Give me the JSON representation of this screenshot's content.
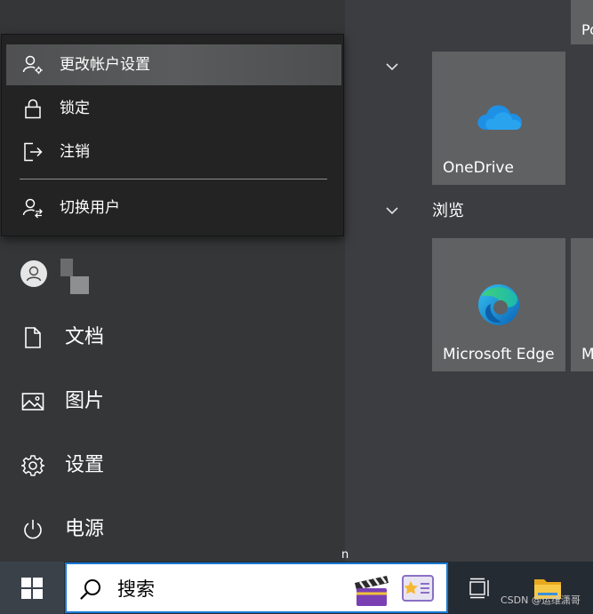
{
  "flyout": {
    "items": [
      {
        "label": "更改帐户设置",
        "icon": "account-settings-icon"
      },
      {
        "label": "锁定",
        "icon": "lock-icon"
      },
      {
        "label": "注销",
        "icon": "sign-out-icon"
      },
      {
        "label": "切换用户",
        "icon": "switch-user-icon"
      }
    ]
  },
  "nav": {
    "items": [
      {
        "label": "文档",
        "icon": "document-icon"
      },
      {
        "label": "图片",
        "icon": "pictures-icon"
      },
      {
        "label": "设置",
        "icon": "gear-icon"
      },
      {
        "label": "电源",
        "icon": "power-icon"
      }
    ]
  },
  "groups": {
    "browse_title": "浏览"
  },
  "tiles": {
    "onedrive": "OneDrive",
    "edge": "Microsoft Edge",
    "partial_top": "Po",
    "partial_right": "M"
  },
  "taskbar": {
    "search_label": "搜索",
    "watermark": "CSDN @运维潇哥",
    "stray_char": "n"
  },
  "colors": {
    "accent": "#1779d4",
    "tile": "#606163",
    "flyout_bg": "#232323",
    "taskbar": "#252b33"
  }
}
